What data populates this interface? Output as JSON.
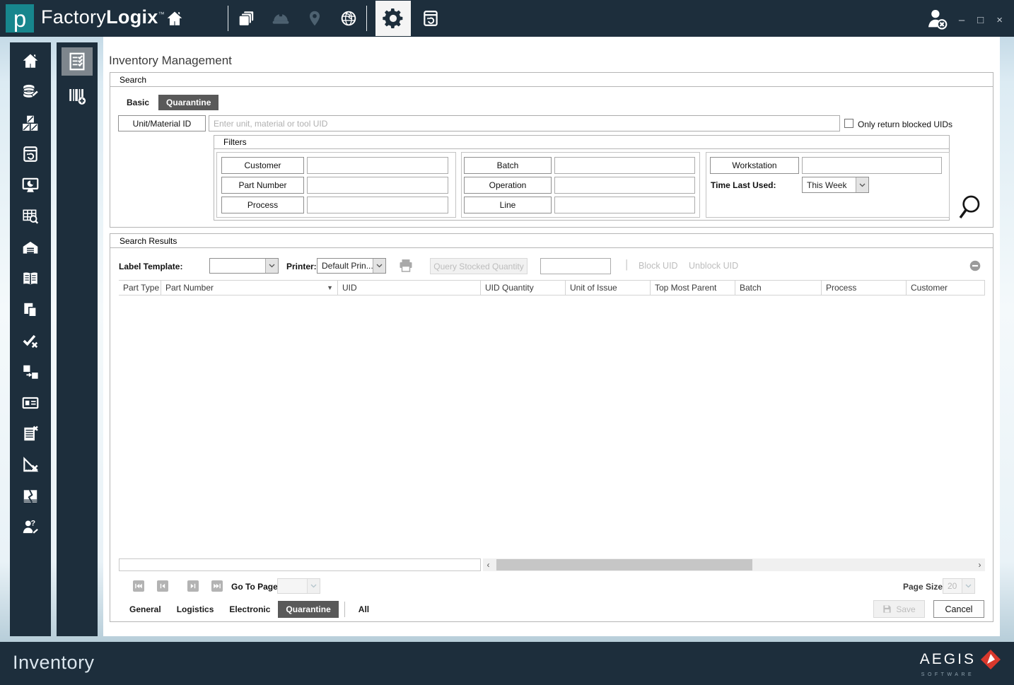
{
  "brand": {
    "logo_letter": "p",
    "name_light": "Factory",
    "name_bold": "Logix",
    "trademark": "™"
  },
  "window_controls": {
    "minimize": "–",
    "maximize": "□",
    "close": "×"
  },
  "page": {
    "title": "Inventory Management"
  },
  "search": {
    "box_title": "Search",
    "tabs": [
      {
        "label": "Basic",
        "active": false
      },
      {
        "label": "Quarantine",
        "active": true
      }
    ],
    "uid_button": "Unit/Material ID",
    "uid_placeholder": "Enter unit, material or tool UID",
    "blocked_checkbox_label": "Only return blocked UIDs",
    "filters": {
      "box_title": "Filters",
      "left": [
        {
          "button": "Customer",
          "value": ""
        },
        {
          "button": "Part Number",
          "value": ""
        },
        {
          "button": "Process",
          "value": ""
        }
      ],
      "middle": [
        {
          "button": "Batch",
          "value": ""
        },
        {
          "button": "Operation",
          "value": ""
        },
        {
          "button": "Line",
          "value": ""
        }
      ],
      "workstation_button": "Workstation",
      "workstation_value": "",
      "time_last_used_label": "Time Last Used:",
      "time_last_used_value": "This Week"
    }
  },
  "results": {
    "box_title": "Search Results",
    "label_template_label": "Label Template:",
    "label_template_value": "",
    "printer_label": "Printer:",
    "printer_value": "Default Prin...",
    "query_button": "Query Stocked Quantity",
    "quantity_value": "",
    "separator": "|",
    "block_uid": "Block UID",
    "unblock_uid": "Unblock UID",
    "columns": [
      "Part Type",
      "Part Number",
      "UID",
      "UID Quantity",
      "Unit of Issue",
      "Top Most Parent",
      "Batch",
      "Process",
      "Customer"
    ],
    "rows": [],
    "pager": {
      "go_to_page_label": "Go To Page",
      "page_value": "",
      "page_size_label": "Page Size",
      "page_size_value": "20"
    },
    "bottom_tabs": [
      {
        "label": "General",
        "active": false
      },
      {
        "label": "Logistics",
        "active": false
      },
      {
        "label": "Electronic",
        "active": false
      },
      {
        "label": "Quarantine",
        "active": true
      },
      {
        "label": "All",
        "active": false
      }
    ],
    "save_button": "Save",
    "cancel_button": "Cancel"
  },
  "footer": {
    "title": "Inventory",
    "logo_text": "AEGIS",
    "logo_sub": "SOFTWARE"
  },
  "icons": {
    "topbar": [
      "pages-icon",
      "operator-helmet-icon",
      "location-pin-icon",
      "globe-icon",
      "settings-gear-icon",
      "backup-icon",
      "user-logout-icon"
    ],
    "sidebar_primary": [
      "home-icon",
      "inventory-database-icon",
      "material-boxes-icon",
      "backup-restore-icon",
      "dashboard-monitor-icon",
      "data-grid-search-icon",
      "warehouse-icon",
      "documentation-book-icon",
      "documents-icon",
      "approve-reject-icon",
      "transfer-icon",
      "id-card-icon",
      "remove-list-icon",
      "measure-reject-icon",
      "damaged-goods-icon",
      "user-question-icon"
    ],
    "sidebar_secondary": [
      "inventory-checklist-icon",
      "barcode-add-icon"
    ],
    "toolbar": [
      "printer-icon",
      "minus-circle-icon",
      "search-magnifier-icon",
      "save-floppy-icon"
    ]
  },
  "colors": {
    "navy": "#1d2e3c",
    "teal": "#17868d",
    "active_tab": "#595959",
    "accent_red": "#d9382c"
  }
}
